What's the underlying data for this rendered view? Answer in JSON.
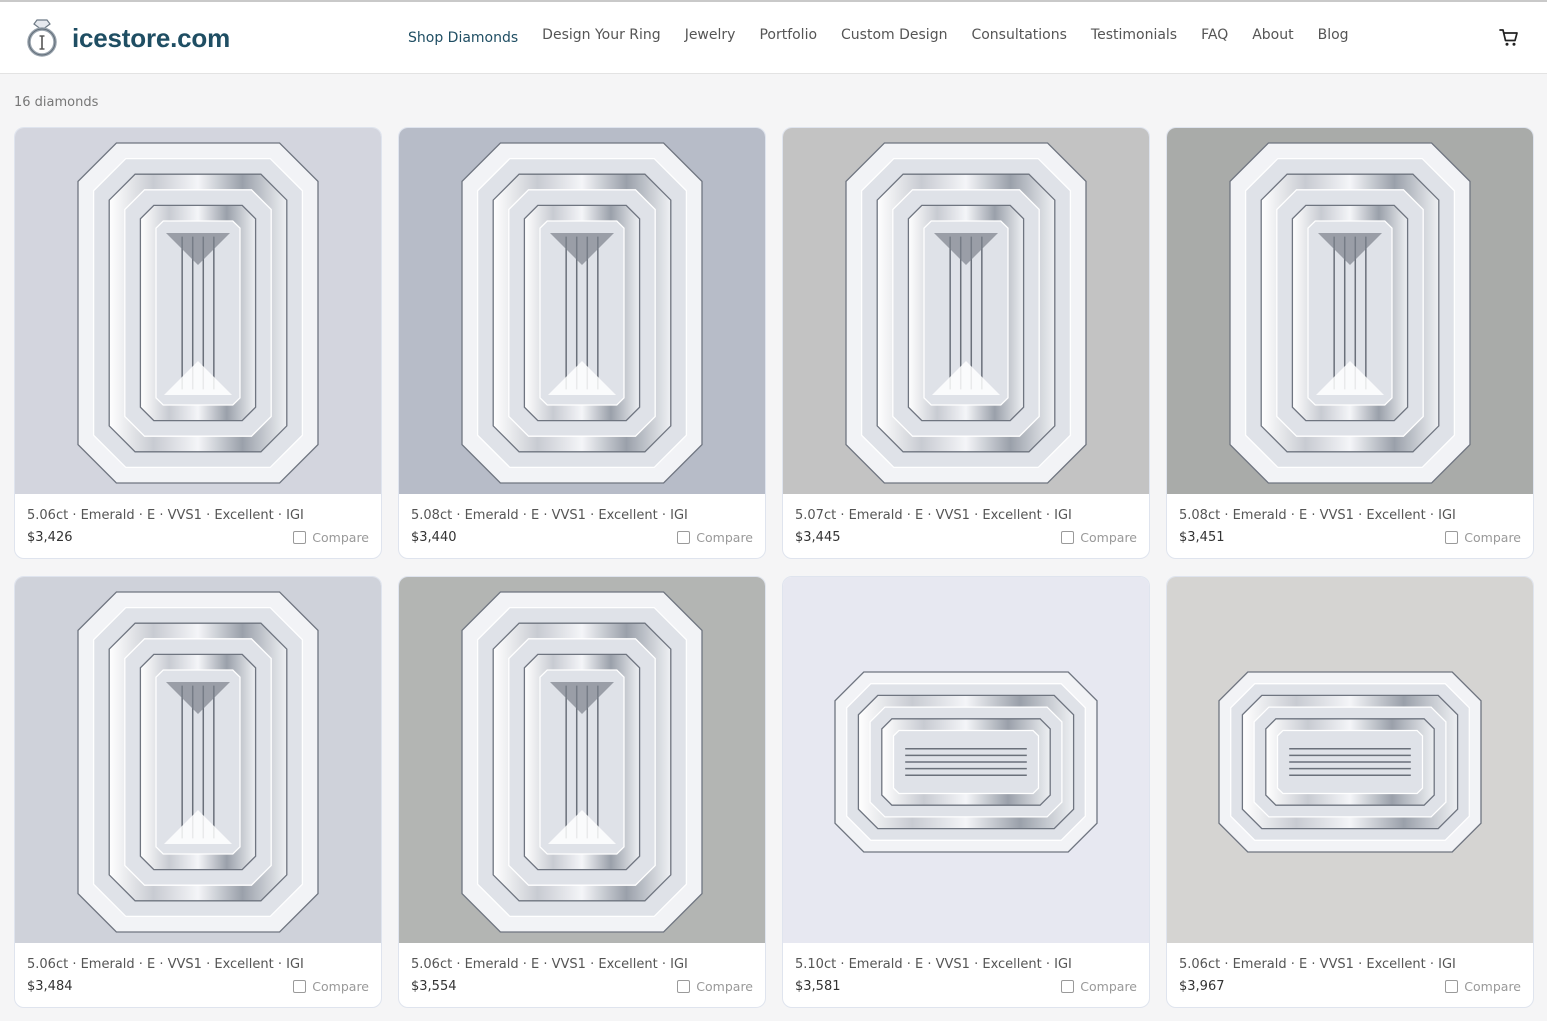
{
  "brand": {
    "name": "icestore.com",
    "logo_icon": "ring-logo-icon"
  },
  "nav": {
    "items": [
      {
        "label": "Shop Diamonds",
        "active": true
      },
      {
        "label": "Design Your Ring"
      },
      {
        "label": "Jewelry"
      },
      {
        "label": "Portfolio"
      },
      {
        "label": "Custom Design"
      },
      {
        "label": "Consultations"
      },
      {
        "label": "Testimonials"
      },
      {
        "label": "FAQ"
      },
      {
        "label": "About"
      },
      {
        "label": "Blog"
      }
    ],
    "cart_icon": "cart-icon"
  },
  "results": {
    "count_text": "16 diamonds"
  },
  "compare_label": "Compare",
  "colors": {
    "brand": "#1f4e63",
    "card_border": "#dfe4ee"
  },
  "diamonds": [
    {
      "specs": "5.06ct · Emerald · E · VVS1 · Excellent · IGI",
      "price": "$3,426",
      "bg": "#d3d5de"
    },
    {
      "specs": "5.08ct · Emerald · E · VVS1 · Excellent · IGI",
      "price": "$3,440",
      "bg": "#b7bcc8"
    },
    {
      "specs": "5.07ct · Emerald · E · VVS1 · Excellent · IGI",
      "price": "$3,445",
      "bg": "#c3c3c3"
    },
    {
      "specs": "5.08ct · Emerald · E · VVS1 · Excellent · IGI",
      "price": "$3,451",
      "bg": "#a9aba9"
    },
    {
      "specs": "5.06ct · Emerald · E · VVS1 · Excellent · IGI",
      "price": "$3,484",
      "bg": "#cfd2da"
    },
    {
      "specs": "5.06ct · Emerald · E · VVS1 · Excellent · IGI",
      "price": "$3,554",
      "bg": "#b3b5b3"
    },
    {
      "specs": "5.10ct · Emerald · E · VVS1 · Excellent · IGI",
      "price": "$3,581",
      "bg": "#e7e8f1"
    },
    {
      "specs": "5.06ct · Emerald · E · VVS1 · Excellent · IGI",
      "price": "$3,967",
      "bg": "#d5d4d2"
    }
  ]
}
